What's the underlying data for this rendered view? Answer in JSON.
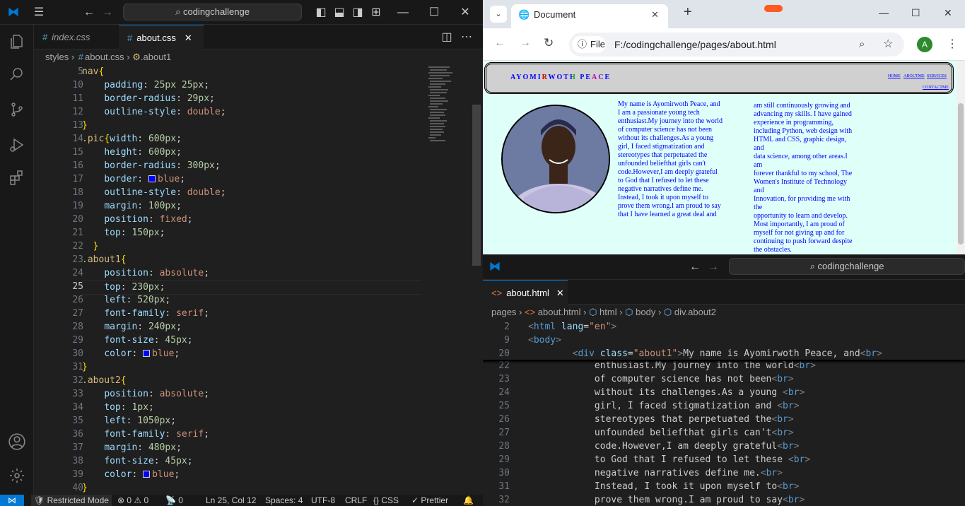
{
  "left_editor": {
    "search": "codingchallenge",
    "tabs": [
      {
        "label": "index.css"
      },
      {
        "label": "about.css"
      }
    ],
    "breadcrumb": [
      "styles",
      "about.css",
      ".about1"
    ],
    "lines": [
      {
        "n": "5",
        "t": "nav{"
      },
      {
        "n": "10",
        "t": "    padding: 25px 25px;"
      },
      {
        "n": "11",
        "t": "    border-radius: 29px;"
      },
      {
        "n": "12",
        "t": "    outline-style: double;"
      },
      {
        "n": "13",
        "t": "}"
      },
      {
        "n": "14",
        "t": ".pic{width: 600px;"
      },
      {
        "n": "15",
        "t": "    height: 600px;"
      },
      {
        "n": "16",
        "t": "    border-radius: 300px;"
      },
      {
        "n": "17",
        "t": "    border: blue;"
      },
      {
        "n": "18",
        "t": "    outline-style: double;"
      },
      {
        "n": "19",
        "t": "    margin: 100px;"
      },
      {
        "n": "20",
        "t": "    position: fixed;"
      },
      {
        "n": "21",
        "t": "    top: 150px;"
      },
      {
        "n": "22",
        "t": "  }"
      },
      {
        "n": "23",
        "t": ".about1{"
      },
      {
        "n": "24",
        "t": "    position: absolute;"
      },
      {
        "n": "25",
        "t": "    top: 230px;"
      },
      {
        "n": "26",
        "t": "    left: 520px;"
      },
      {
        "n": "27",
        "t": "    font-family: serif;"
      },
      {
        "n": "28",
        "t": "    margin: 240px;"
      },
      {
        "n": "29",
        "t": "    font-size: 45px;"
      },
      {
        "n": "30",
        "t": "    color: blue;"
      },
      {
        "n": "31",
        "t": "}"
      },
      {
        "n": "32",
        "t": ".about2{"
      },
      {
        "n": "33",
        "t": "    position: absolute;"
      },
      {
        "n": "34",
        "t": "    top: 1px;"
      },
      {
        "n": "35",
        "t": "    left: 1050px;"
      },
      {
        "n": "36",
        "t": "    font-family: serif;"
      },
      {
        "n": "37",
        "t": "    margin: 480px;"
      },
      {
        "n": "38",
        "t": "    font-size: 45px;"
      },
      {
        "n": "39",
        "t": "    color: blue;"
      },
      {
        "n": "40",
        "t": "}"
      }
    ],
    "status": {
      "restricted": "Restricted Mode",
      "errors": "0",
      "warnings": "0",
      "ports": "0",
      "position": "Ln 25, Col 12",
      "spaces": "Spaces: 4",
      "encoding": "UTF-8",
      "eol": "CRLF",
      "language": "CSS",
      "formatter": "Prettier"
    }
  },
  "browser": {
    "tab_title": "Document",
    "url_chip": "File",
    "url": "F:/codingchallenge/pages/about.html",
    "avatar": "A",
    "brand": "AYOMIRWOTH PEACE",
    "nav_links": [
      "HOME",
      "ABOUTME",
      "SERVICES",
      "CONTACTME"
    ],
    "about1": "My name is Ayomirwoth Peace, and\nI am a passionate young tech\nenthusiast.My journey into the world\nof computer science has not been\nwithout its challenges.As a young\ngirl, I faced stigmatization and\nstereotypes that perpetuated the\nunfounded beliefthat girls can't\ncode.However,I am deeply grateful\nto God that I refused to let these\nnegative narratives define me.\nInstead, I took it upon myself to\nprove them wrong.I am proud to say\nthat I have learned a great deal and",
    "about2": "am still continuously growing and\nadvancing my skills. I have gained\nexperience in programming,\nincluding Python, web design with\nHTML and CSS, graphic design,\nand\ndata science, among other areas.I\nam\nforever thankful to my school, The\nWomen's Institute of Technology\nand\nInnovation, for providing me with\nthe\nopportunity to learn and develop.\nMost importantly, I am proud of\nmyself for not giving up and for\ncontinuing to push forward despite\nthe obstacles."
  },
  "right_editor": {
    "search": "codingchallenge",
    "tab": "about.html",
    "breadcrumb": [
      "pages",
      "about.html",
      "html",
      "body",
      "div.about2"
    ],
    "sticky": [
      {
        "n": "2",
        "t": "<html lang=\"en\">"
      },
      {
        "n": "9",
        "t": "<body>"
      },
      {
        "n": "20",
        "t": "        <div class=\"about1\">My name is Ayomirwoth Peace, and<br>"
      }
    ],
    "lines": [
      {
        "n": "22",
        "t": "            enthusiast.My journey into the world<br>"
      },
      {
        "n": "23",
        "t": "            of computer science has not been<br>"
      },
      {
        "n": "24",
        "t": "            without its challenges.As a young <br>"
      },
      {
        "n": "25",
        "t": "            girl, I faced stigmatization and <br>"
      },
      {
        "n": "26",
        "t": "            stereotypes that perpetuated the<br>"
      },
      {
        "n": "27",
        "t": "            unfounded beliefthat girls can't<br>"
      },
      {
        "n": "28",
        "t": "            code.However,I am deeply grateful<br>"
      },
      {
        "n": "29",
        "t": "            to God that I refused to let these <br>"
      },
      {
        "n": "30",
        "t": "            negative narratives define me.<br>"
      },
      {
        "n": "31",
        "t": "            Instead, I took it upon myself to<br>"
      },
      {
        "n": "32",
        "t": "            prove them wrong.I am proud to say<br>"
      }
    ]
  },
  "colors": {
    "accent": "#0078d4",
    "page_bg": "#dffff9",
    "text_blue": "#0000ff"
  }
}
